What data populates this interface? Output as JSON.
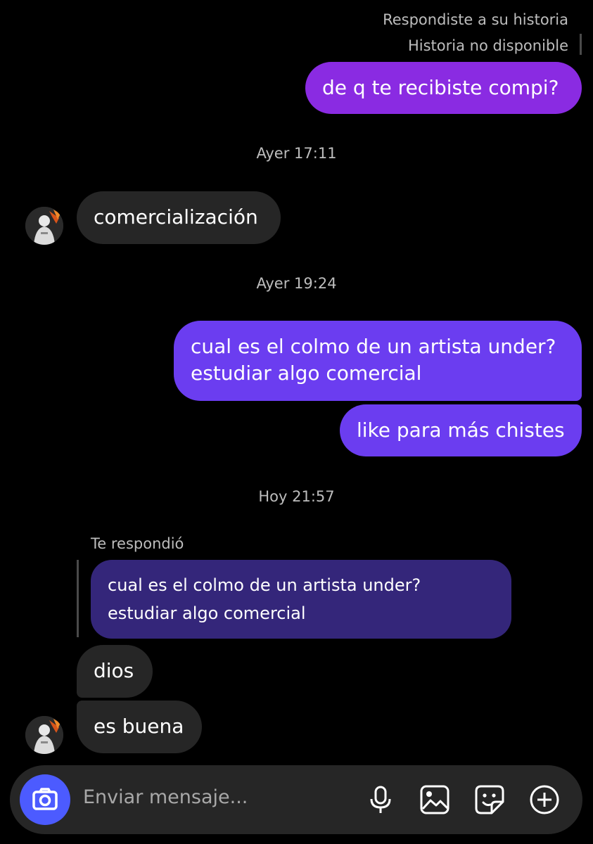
{
  "story_reply": {
    "label": "Respondiste a su historia",
    "unavailable": "Historia no disponible"
  },
  "messages": {
    "out_1": "de q te recibiste compi?",
    "ts_1": "Ayer 17:11",
    "in_1": "comercialización",
    "ts_2": "Ayer 19:24",
    "out_2_line1": "cual es el colmo de un artista under?",
    "out_2_line2": "estudiar algo comercial",
    "out_3": "like para más chistes",
    "ts_3": "Hoy 21:57",
    "reply_label": "Te respondió",
    "quote_line1": "cual es el colmo de un artista under?",
    "quote_line2": "estudiar algo comercial",
    "in_2": "dios",
    "in_3": "es buena"
  },
  "composer": {
    "placeholder": "Enviar mensaje...",
    "icons": [
      "camera-icon",
      "microphone-icon",
      "gallery-icon",
      "sticker-icon",
      "plus-icon"
    ]
  },
  "colors": {
    "outgoing_purple": "#8a2be2",
    "outgoing_violet": "#6b3df0",
    "incoming": "#262626",
    "quote": "#34267a",
    "camera_button": "#4c5bff"
  }
}
